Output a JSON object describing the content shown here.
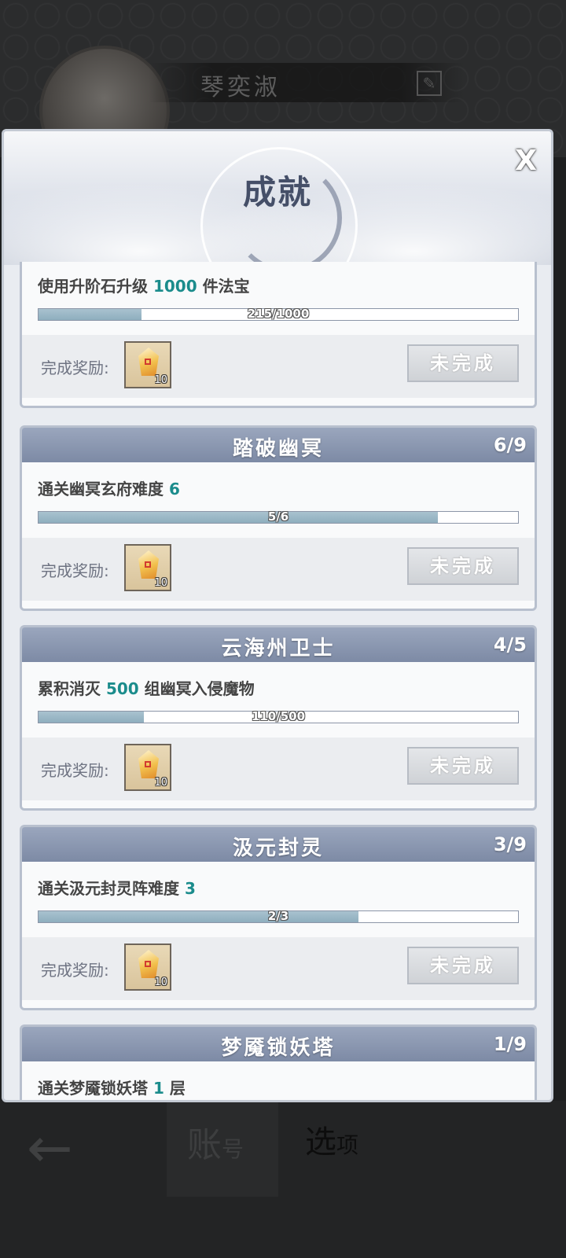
{
  "background": {
    "player_name": "琴奕淑",
    "bottom_tabs": [
      {
        "label_main": "账",
        "label_sub": "号"
      },
      {
        "label_main": "选",
        "label_sub": "项"
      }
    ]
  },
  "modal": {
    "title": "成就",
    "close_icon": "X",
    "reward_label": "完成奖励:",
    "status_label": "未完成"
  },
  "achievements": [
    {
      "title": "",
      "count": "",
      "task_prefix": "使用升阶石升级 ",
      "task_number": "1000",
      "task_suffix": " 件法宝",
      "progress_text": "215/1000",
      "progress_fraction": 0.215,
      "reward_qty": "10"
    },
    {
      "title": "踏破幽冥",
      "count": "6/9",
      "task_prefix": "通关幽冥玄府难度 ",
      "task_number": "6",
      "task_suffix": "",
      "progress_text": "5/6",
      "progress_fraction": 0.8333,
      "reward_qty": "10"
    },
    {
      "title": "云海州卫士",
      "count": "4/5",
      "task_prefix": "累积消灭 ",
      "task_number": "500",
      "task_suffix": " 组幽冥入侵魔物",
      "progress_text": "110/500",
      "progress_fraction": 0.22,
      "reward_qty": "10"
    },
    {
      "title": "汲元封灵",
      "count": "3/9",
      "task_prefix": "通关汲元封灵阵难度 ",
      "task_number": "3",
      "task_suffix": "",
      "progress_text": "2/3",
      "progress_fraction": 0.6667,
      "reward_qty": "10"
    },
    {
      "title": "梦魇锁妖塔",
      "count": "1/9",
      "task_prefix": "通关梦魇锁妖塔 ",
      "task_number": "1",
      "task_suffix": " 层",
      "progress_text": "",
      "progress_fraction": 0,
      "reward_qty": ""
    }
  ]
}
